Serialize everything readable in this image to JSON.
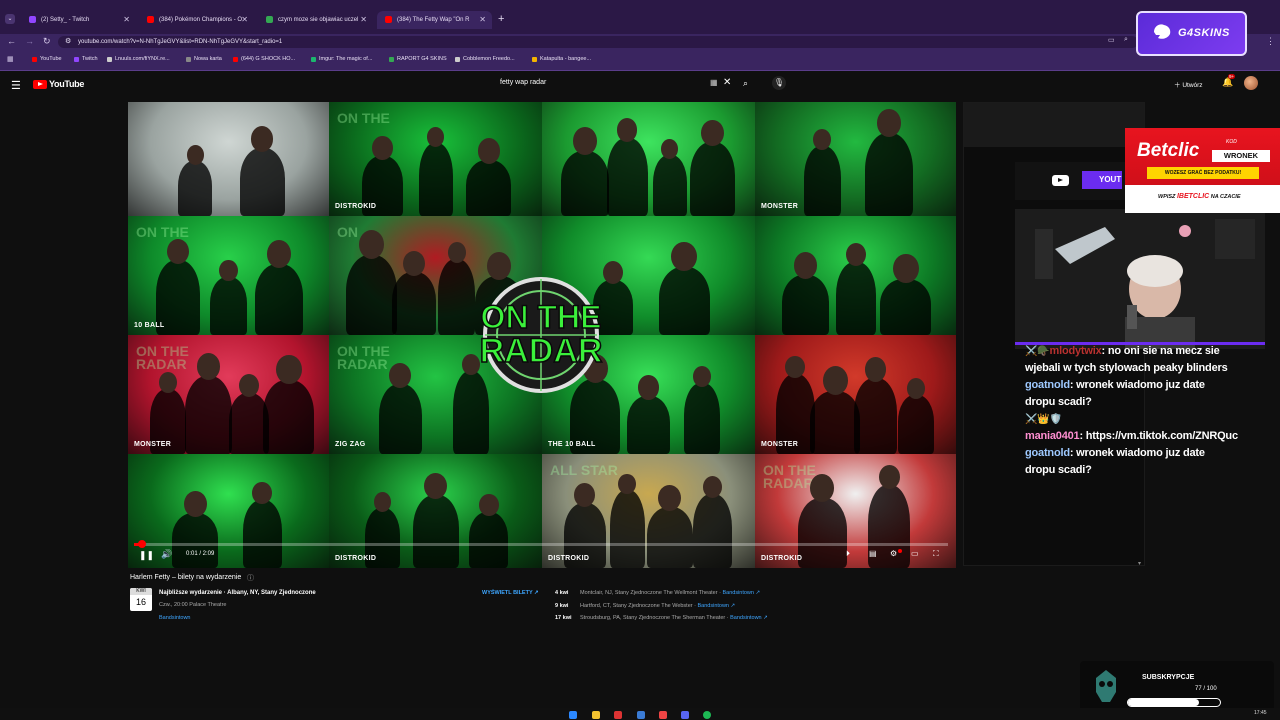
{
  "browser": {
    "tabs": [
      {
        "label": "(2) Setty_ - Twitch",
        "color": "#9146ff",
        "active": false
      },
      {
        "label": "(384) Pokémon Champions - O",
        "color": "#ff0000",
        "active": false
      },
      {
        "label": "czym moze sie objawiac uczel",
        "color": "#34a853",
        "active": false
      },
      {
        "label": "(384) The Fetty Wap \"On R",
        "color": "#ff0000",
        "active": true
      }
    ],
    "url": "youtube.com/watch?v=N-NhTgJeGVY&list=RDN-NhTgJeGVY&start_radio=1",
    "bookmarks": [
      {
        "label": "YouTube",
        "color": "#ff0000"
      },
      {
        "label": "Twitch",
        "color": "#9146ff"
      },
      {
        "label": "Lnuuls.com/fiYNX.re...",
        "color": "#cccccc"
      },
      {
        "label": "Nowa karta",
        "color": "#888888"
      },
      {
        "label": "(644) G SHOCK HO...",
        "color": "#ff0000"
      },
      {
        "label": "Imgur: The magic of...",
        "color": "#1bb76e"
      },
      {
        "label": "RAPORT G4 SKINS",
        "color": "#34a853"
      },
      {
        "label": "Cobblemon Freedo...",
        "color": "#cccccc"
      },
      {
        "label": "Katapulta - bangee...",
        "color": "#f4b400"
      }
    ]
  },
  "overlay_sponsor": {
    "brand": "G4SKINS"
  },
  "youtube": {
    "logo_text": "YouTube",
    "search_value": "fetty wap radar",
    "create_label": "Utwórz",
    "notification_count": "9+"
  },
  "video": {
    "time_display": "0:01 / 2:09",
    "progress": 0.008,
    "center_logo_line1": "ON THE",
    "center_logo_line2": "RADAR",
    "tiles": [
      {
        "bg": "#9aa3a0",
        "accent": "#cfd6d3",
        "watermark": "",
        "brand": ""
      },
      {
        "bg": "#0b6b1d",
        "accent": "#19c03a",
        "watermark": "DISTROKID",
        "brand": "ON THE"
      },
      {
        "bg": "#1b9a30",
        "accent": "#3ee45f",
        "watermark": "",
        "brand": ""
      },
      {
        "bg": "#136b22",
        "accent": "#22b940",
        "watermark": "MONSTER",
        "brand": ""
      },
      {
        "bg": "#0e8a2a",
        "accent": "#28d04a",
        "watermark": "10 BALL",
        "brand": "ON THE"
      },
      {
        "bg": "#1f7b33",
        "accent": "#b01b22",
        "watermark": "",
        "brand": "ON"
      },
      {
        "bg": "#108c2a",
        "accent": "#35da55",
        "watermark": "",
        "brand": ""
      },
      {
        "bg": "#0d7a25",
        "accent": "#2bd04b",
        "watermark": "",
        "brand": ""
      },
      {
        "bg": "#b2142d",
        "accent": "#e23b5a",
        "watermark": "MONSTER",
        "brand": "ON THE RADAR"
      },
      {
        "bg": "#0d7523",
        "accent": "#23c444",
        "watermark": "ZIG ZAG",
        "brand": "ON THE RADAR"
      },
      {
        "bg": "#108c2a",
        "accent": "#38e058",
        "watermark": "THE 10 BALL",
        "brand": ""
      },
      {
        "bg": "#9e1a1a",
        "accent": "#d23a2a",
        "watermark": "MONSTER",
        "brand": ""
      },
      {
        "bg": "#0a6a1c",
        "accent": "#30e050",
        "watermark": "",
        "brand": ""
      },
      {
        "bg": "#0a5c18",
        "accent": "#2bd04b",
        "watermark": "DISTROKID",
        "brand": ""
      },
      {
        "bg": "#8a8f7a",
        "accent": "#c8a850",
        "watermark": "DISTROKID",
        "brand": "ALL STAR"
      },
      {
        "bg": "#c23a3a",
        "accent": "#f0f0f0",
        "watermark": "DISTROKID",
        "brand": "ON THE RADAR"
      }
    ]
  },
  "events": {
    "title": "Harlem Fetty – bilety na wydarzenie",
    "info_icon": "info-icon",
    "date_month": "KWI",
    "date_day": "16",
    "main_name": "Najbliższe wydarzenie · Albany, NY, Stany Zjednoczone",
    "main_time": "Czw., 20:00 Palace Theatre",
    "main_provider": "Bandsintown",
    "tickets_button": "WYŚWIETL BILETY ↗",
    "upcoming": [
      {
        "date": "4 kwi",
        "place": "Montclair, NJ, Stany Zjednoczone The Wellmont Theater",
        "provider": "Bandsintown ↗"
      },
      {
        "date": "9 kwi",
        "place": "Hartford, CT, Stany Zjednoczone The Webster",
        "provider": "Bandsintown ↗"
      },
      {
        "date": "17 kwi",
        "place": "Stroudsburg, PA, Stany Zjednoczone The Sherman Theater",
        "provider": "Bandsintown ↗"
      }
    ]
  },
  "stream_overlay": {
    "yt_sub_label": "YOUT",
    "betclic": {
      "logo": "Betclic",
      "kod_label": "KOD",
      "code": "WRONEK",
      "tax_text": "WOZESZ GRAĆ BEZ PODATKU!",
      "promo_prefix": "WPISZ",
      "promo_brand": "IBETCLIC",
      "promo_suffix": "NA CZACIE"
    },
    "chat": [
      {
        "badges": "⚔️🪖",
        "user": "mlodytwix",
        "user_color": "#b9312f",
        "text": ": no oni sie na mecz sie"
      },
      {
        "badges": "",
        "user": "",
        "user_color": "#ffffff",
        "text": "wjebali w tych stylowach peaky blinders"
      },
      {
        "badges": "",
        "user": "goatnold",
        "user_color": "#9ec9ff",
        "text": ": wronek wiadomo juz date"
      },
      {
        "badges": "",
        "user": "",
        "user_color": "#ffffff",
        "text": "dropu scadi?"
      },
      {
        "badges": "⚔️👑🛡️",
        "user": "",
        "user_color": "#ffffff",
        "text": ""
      },
      {
        "badges": "",
        "user": "mania0401",
        "user_color": "#ff8fd1",
        "text": ": https://vm.tiktok.com/ZNRQuc"
      },
      {
        "badges": "",
        "user": "goatnold",
        "user_color": "#9ec9ff",
        "text": ": wronek wiadomo juz date"
      },
      {
        "badges": "",
        "user": "",
        "user_color": "#ffffff",
        "text": "dropu scadi?"
      }
    ],
    "subs": {
      "title": "SUBSKRYPCJE",
      "count_text": "77 / 100",
      "current": 77,
      "goal": 100
    }
  },
  "taskbar": {
    "clock": "17:45"
  }
}
